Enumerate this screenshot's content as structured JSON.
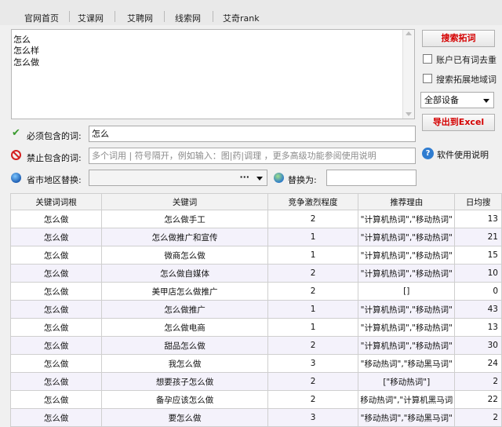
{
  "nav": {
    "tabs": [
      "官网首页",
      "艾课网",
      "艾聘网",
      "线索网",
      "艾奇rank"
    ]
  },
  "keywords_input": {
    "lines": [
      "怎么",
      "怎么样",
      "怎么做"
    ]
  },
  "actions": {
    "search_button": "搜索拓词",
    "dedupe_label": "账户已有词去重",
    "expand_region_label": "搜索拓展地域词",
    "device_select": "全部设备",
    "export_button": "导出到Excel",
    "help_label": "软件使用说明"
  },
  "filters": {
    "must_include_label": "必须包含的词:",
    "must_include_value": "怎么",
    "exclude_label": "禁止包含的词:",
    "exclude_placeholder": "多个词用 | 符号隔开，例如输入：图|药|调理 ，更多高级功能参阅使用说明",
    "region_label": "省市地区替换:",
    "region_more": "···",
    "replace_label": "替换为:"
  },
  "table": {
    "columns": [
      "关键词词根",
      "关键词",
      "竞争激烈程度",
      "推荐理由",
      "日均搜"
    ],
    "rows": [
      [
        "怎么做",
        "怎么做手工",
        "2",
        "\"计算机热词\",\"移动热词\"",
        "13"
      ],
      [
        "怎么做",
        "怎么做推广和宣传",
        "1",
        "\"计算机热词\",\"移动热词\"",
        "21"
      ],
      [
        "怎么做",
        "微商怎么做",
        "1",
        "\"计算机热词\",\"移动热词\"",
        "15"
      ],
      [
        "怎么做",
        "怎么做自媒体",
        "2",
        "\"计算机热词\",\"移动热词\"",
        "10"
      ],
      [
        "怎么做",
        "美甲店怎么做推广",
        "2",
        "[]",
        "0"
      ],
      [
        "怎么做",
        "怎么做推广",
        "1",
        "\"计算机热词\",\"移动热词\"",
        "43"
      ],
      [
        "怎么做",
        "怎么做电商",
        "1",
        "\"计算机热词\",\"移动热词\"",
        "13"
      ],
      [
        "怎么做",
        "甜品怎么做",
        "2",
        "\"计算机热词\",\"移动热词\"",
        "30"
      ],
      [
        "怎么做",
        "我怎么做",
        "3",
        "\"移动热词\",\"移动黑马词\"",
        "24"
      ],
      [
        "怎么做",
        "想要孩子怎么做",
        "2",
        "[\"移动热词\"]",
        "2"
      ],
      [
        "怎么做",
        "备孕应该怎么做",
        "2",
        "移动热词\",\"计算机黑马词",
        "22"
      ],
      [
        "怎么做",
        "要怎么做",
        "3",
        "\"移动热词\",\"移动黑马词\"",
        "2"
      ]
    ]
  }
}
